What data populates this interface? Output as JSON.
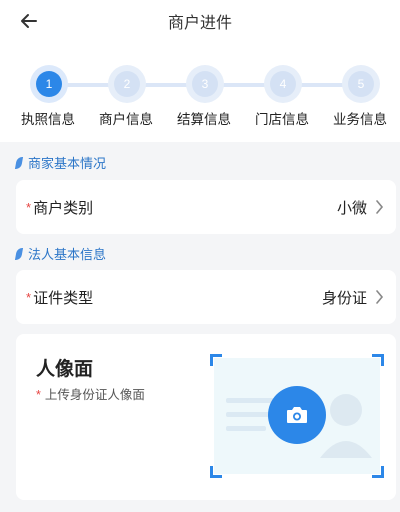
{
  "header": {
    "title": "商户进件",
    "back_icon": "arrow-left-icon"
  },
  "stepper": {
    "active_color": "#2c87e8",
    "steps": [
      {
        "number": "1",
        "label": "执照信息",
        "active": true
      },
      {
        "number": "2",
        "label": "商户信息",
        "active": false
      },
      {
        "number": "3",
        "label": "结算信息",
        "active": false
      },
      {
        "number": "4",
        "label": "门店信息",
        "active": false
      },
      {
        "number": "5",
        "label": "业务信息",
        "active": false
      }
    ]
  },
  "merchant_section": {
    "title": "商家基本情况",
    "row": {
      "required_mark": "*",
      "label": "商户类别",
      "value": "小微"
    }
  },
  "legal_section": {
    "title": "法人基本信息",
    "row": {
      "required_mark": "*",
      "label": "证件类型",
      "value": "身份证"
    }
  },
  "id_upload": {
    "title": "人像面",
    "required_mark": "*",
    "subtitle": "上传身份证人像面",
    "icon": "camera-icon"
  }
}
